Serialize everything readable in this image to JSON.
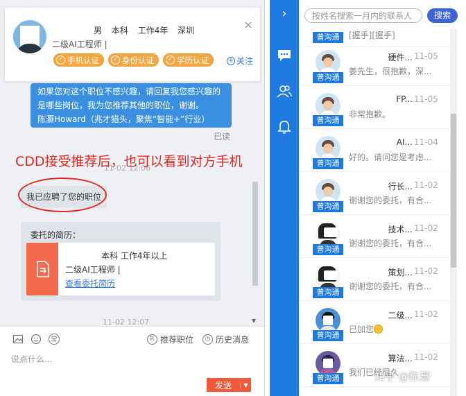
{
  "profile": {
    "gender": "男",
    "education": "本科",
    "experience": "工作4年",
    "city": "深圳",
    "title": "二级AI工程师 |",
    "badges": [
      "手机认证",
      "身份认证",
      "学历认证"
    ],
    "follow_label": "关注",
    "close_glyph": "×"
  },
  "chat": {
    "blue_message_lines": [
      "如果您对这个职位不感兴趣，请回复我您感兴趣的",
      "是哪些岗位，我为您推荐其他的职位，谢谢。",
      "陈灏Howard（兆才猎头，聚焦“智能+”行业）"
    ],
    "read_status": "已读",
    "annotation": "CDD接受推荐后，也可以看到对方手机",
    "timestamp_1": "11-02 12:06",
    "accepted_message": "我已应聘了您的职位",
    "resume_card": {
      "heading": "委托的简历：",
      "line1": "本科  工作4年以上",
      "line2": "二级AI工程师   |",
      "link": "查看委托简历"
    },
    "timestamp_2": "11-02 12:07"
  },
  "composer": {
    "phrase_glyph": "常",
    "recommend_label": "推荐职位",
    "recommend_glyph": "R",
    "history_label": "历史消息",
    "history_glyph": "◷",
    "placeholder": "说点什么...",
    "send_label": "发送",
    "send_caret": "▼"
  },
  "nav": {
    "collapse_glyph": "›"
  },
  "search": {
    "placeholder": "按姓名搜索一月内的联系人",
    "button_label": "搜索"
  },
  "contacts": {
    "first_row": {
      "tag": "曾沟通",
      "message": "[握手][握手]"
    },
    "rows": [
      {
        "name": "硬件...",
        "date": "11-05",
        "message": "姜先生，很抱歉，深...",
        "tag": "曾沟通",
        "avatar": "cartoon"
      },
      {
        "name": "FP...",
        "date": "11-05",
        "message": "非常抱歉。",
        "tag": "曾沟通",
        "avatar": "cartoon"
      },
      {
        "name": "AI...",
        "date": "11-04",
        "message": "好的。请问您是考虑...",
        "tag": "曾沟通",
        "avatar": "cartoon"
      },
      {
        "name": "行长...",
        "date": "11-02",
        "message": "谢谢您的委托，有合...",
        "tag": "曾沟通",
        "avatar": "cartoon"
      },
      {
        "name": "技术...",
        "date": "11-02",
        "message": "谢谢您的委托，有合...",
        "tag": "曾沟通",
        "avatar": "dark"
      },
      {
        "name": "策划...",
        "date": "11-02",
        "message": "谢谢您的委托，有合...",
        "tag": "曾沟通",
        "avatar": "dark"
      },
      {
        "name": "二级...",
        "date": "11-02",
        "message": "已加您",
        "tag": "曾沟通",
        "avatar": "blue",
        "emoji": true
      },
      {
        "name": "算法...",
        "date": "11-02",
        "message": "我们已经很久",
        "tag": "曾沟通",
        "avatar": "photo"
      }
    ]
  },
  "watermark": "知乎 @陈灏",
  "colors": {
    "nav_blue": "#1f7ae0",
    "badge_orange": "#f5a640",
    "send_red": "#f05a3a",
    "annotation_red": "#e1281f",
    "search_button": "#3d64d6"
  }
}
